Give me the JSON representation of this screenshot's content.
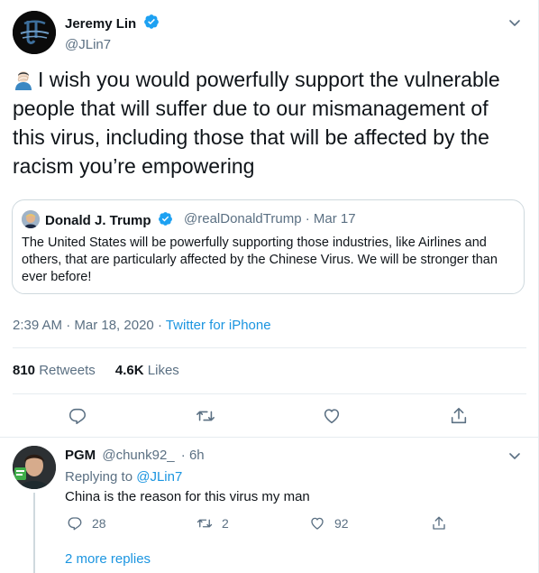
{
  "tweet": {
    "author_name": "Jeremy Lin",
    "author_handle": "@JLin7",
    "text": "I wish you would powerfully support the vulnerable people that will suffer due to our mismanagement of this virus, including those that will be affected by the racism you’re empowering",
    "emoji": "man-facepalming-emoji",
    "timestamp": "2:39 AM · Mar 18, 2020",
    "separator": "·",
    "source": "Twitter for iPhone",
    "retweets_count": "810",
    "retweets_label": "Retweets",
    "likes_count": "4.6K",
    "likes_label": "Likes"
  },
  "quote": {
    "author_name": "Donald J. Trump",
    "author_handle": "@realDonaldTrump",
    "date": "Mar 17",
    "separator": "·",
    "text": "The United States will be powerfully supporting those industries, like Airlines and others, that are particularly affected by the Chinese Virus. We will be stronger than ever before!"
  },
  "reply": {
    "author_name": "PGM",
    "author_handle": "@chunk92_",
    "age": "· 6h",
    "replying_prefix": "Replying to",
    "replying_to": "@JLin7",
    "text": "China is the reason for this virus my man",
    "replies_count": "28",
    "retweets_count": "2",
    "likes_count": "92",
    "more_replies": "2 more replies"
  },
  "colors": {
    "accent": "#1b95e0",
    "secondary_text": "#5b7083",
    "verified": "#1da1f2",
    "divider": "#e6ecf0"
  },
  "icons": [
    "verified-badge-icon",
    "caret-down-icon",
    "reply-icon",
    "retweet-icon",
    "like-icon",
    "share-icon"
  ]
}
